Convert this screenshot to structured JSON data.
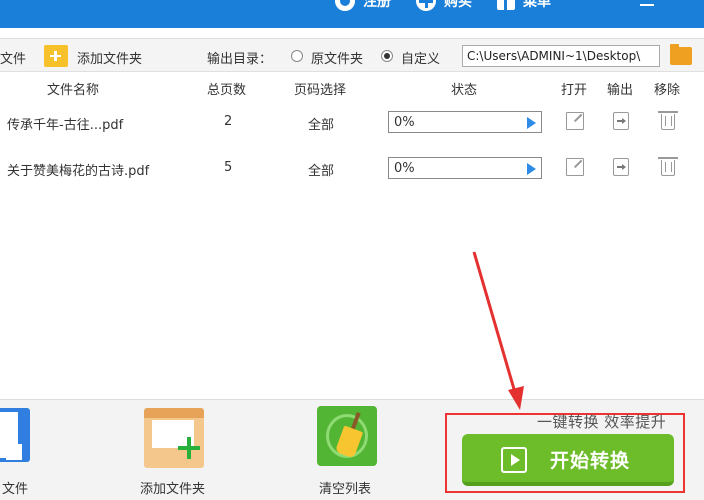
{
  "topbar": {
    "items": [
      {
        "label": "注册",
        "icon": "register-icon"
      },
      {
        "label": "购买",
        "icon": "cart-icon"
      },
      {
        "label": "菜单",
        "icon": "menu-icon"
      }
    ]
  },
  "toolbar": {
    "add_file_partial": "文件",
    "add_folder_label": "添加文件夹",
    "output_dir_label": "输出目录：",
    "radio_original_label": "原文件夹",
    "radio_custom_label": "自定义",
    "selected_output": "自定义",
    "output_path": "C:\\Users\\ADMINI~1\\Desktop\\"
  },
  "table": {
    "headers": {
      "name": "文件名称",
      "pages": "总页数",
      "page_select": "页码选择",
      "status": "状态",
      "open": "打开",
      "output": "输出",
      "remove": "移除"
    },
    "rows": [
      {
        "name": "传承千年-古往...pdf",
        "pages": "2",
        "page_select": "全部",
        "progress": "0%"
      },
      {
        "name": "关于赞美梅花的古诗.pdf",
        "pages": "5",
        "page_select": "全部",
        "progress": "0%"
      }
    ]
  },
  "bottom": {
    "add_file_label": "文件",
    "add_folder_label": "添加文件夹",
    "clear_list_label": "清空列表",
    "tagline": "一键转换  效率提升",
    "start_label": "开始转换"
  },
  "colors": {
    "topbar": "#1a7fd9",
    "start_button": "#6cbd29",
    "highlight": "#ee3333"
  }
}
